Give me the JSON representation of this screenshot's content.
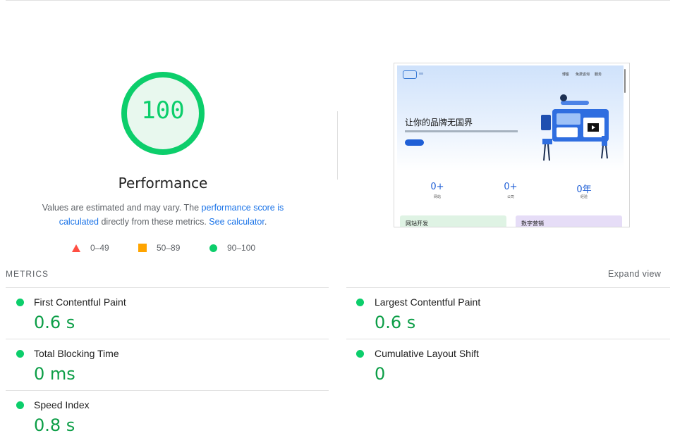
{
  "score": {
    "value": "100",
    "category": "Performance",
    "fraction": 1.0
  },
  "description": {
    "text1": "Values are estimated and may vary. The ",
    "link1": "performance score is calculated",
    "text2": " directly from these metrics. ",
    "link2": "See calculator",
    "text3": "."
  },
  "legend": {
    "fail": "0–49",
    "average": "50–89",
    "pass": "90–100"
  },
  "colors": {
    "pass": "#0cce6b",
    "average": "#ffa400",
    "fail": "#ff4e42",
    "link": "#1a73e8"
  },
  "screenshot": {
    "nav": [
      "博客",
      "免费咨询",
      "服务"
    ],
    "headline": "让你的品牌无国界",
    "stats": [
      {
        "value": "0+",
        "label": "网站"
      },
      {
        "value": "0+",
        "label": "公司"
      },
      {
        "value": "0年",
        "label": "经验"
      }
    ],
    "cards": [
      "网站开发",
      "数字营销"
    ]
  },
  "metrics": {
    "title": "METRICS",
    "expand_label": "Expand view",
    "items": [
      {
        "name": "First Contentful Paint",
        "value": "0.6 s"
      },
      {
        "name": "Largest Contentful Paint",
        "value": "0.6 s"
      },
      {
        "name": "Total Blocking Time",
        "value": "0 ms"
      },
      {
        "name": "Cumulative Layout Shift",
        "value": "0"
      },
      {
        "name": "Speed Index",
        "value": "0.8 s"
      }
    ]
  }
}
